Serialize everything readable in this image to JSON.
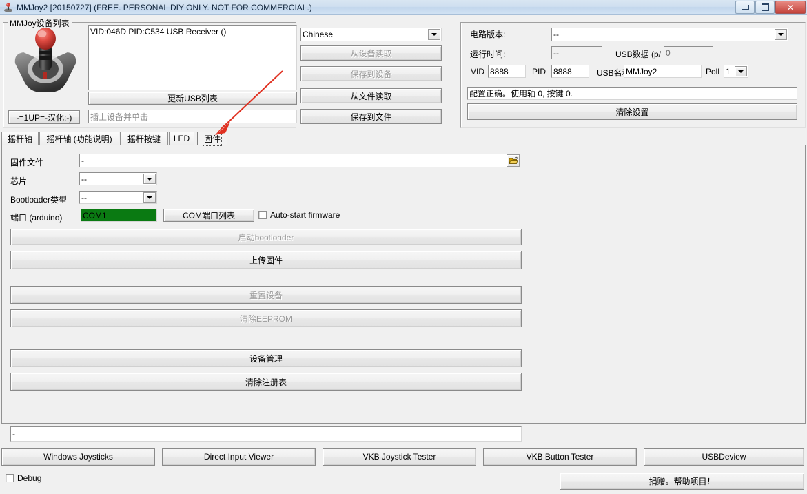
{
  "window": {
    "title": "MMJoy2 [20150727] (FREE. PERSONAL DIY ONLY. NOT FOR COMMERCIAL.)",
    "app_icon": "joystick-icon",
    "minimize_label": "",
    "maximize_label": "",
    "close_label": "✕"
  },
  "device_group": {
    "title": "MMJoy设备列表",
    "device_list": [
      "VID:046D PID:C534 USB Receiver ()"
    ],
    "refresh_usb_label": "更新USB列表",
    "hint_placeholder": "插上设备并单击",
    "translator_label": "-=1UP=-汉化:-)"
  },
  "actions": {
    "language_value": "Chinese",
    "read_from_device": "从设备读取",
    "save_to_device": "保存到设备",
    "read_from_file": "从文件读取",
    "save_to_file": "保存到文件"
  },
  "info": {
    "board_version_label": "电路版本:",
    "board_version_value": "--",
    "runtime_label": "运行时间:",
    "runtime_value": "--",
    "usb_rate_label": "USB数据 (p/",
    "usb_rate_value": "0",
    "vid_label": "VID",
    "vid_value": "8888",
    "pid_label": "PID",
    "pid_value": "8888",
    "usb_name_label": "USB名称",
    "usb_name_value": "MMJoy2",
    "poll_label": "Poll",
    "poll_value": "1",
    "status_value": "配置正确。使用轴 0, 按键 0.",
    "clear_settings": "清除设置"
  },
  "tabs": [
    {
      "label": "摇杆轴",
      "selected": false
    },
    {
      "label": "摇杆轴 (功能说明)",
      "selected": false
    },
    {
      "label": "摇杆按键",
      "selected": false
    },
    {
      "label": "LED",
      "selected": false
    },
    {
      "label": "固件",
      "selected": true
    }
  ],
  "firmware": {
    "file_label": "固件文件",
    "file_value": "-",
    "browse_icon": "open-folder-icon",
    "chip_label": "芯片",
    "chip_value": "--",
    "bootloader_label": "Bootloader类型",
    "bootloader_value": "--",
    "port_label": "端口 (arduino)",
    "port_value": "COM1",
    "port_bg_color": "#0a7a12",
    "com_list_button": "COM端口列表",
    "autostart_label": "Auto-start firmware",
    "autostart_checked": false,
    "buttons": [
      {
        "label": "启动bootloader",
        "enabled": false
      },
      {
        "label": "上传固件",
        "enabled": true
      },
      {
        "label": "重置设备",
        "enabled": false
      },
      {
        "label": "清除EEPROM",
        "enabled": false
      },
      {
        "label": "设备管理",
        "enabled": true
      },
      {
        "label": "清除注册表",
        "enabled": true
      }
    ]
  },
  "bottom": {
    "log_value": "-",
    "tools": [
      "Windows Joysticks",
      "Direct Input Viewer",
      "VKB Joystick Tester",
      "VKB Button Tester",
      "USBDeview"
    ],
    "debug_label": "Debug",
    "debug_checked": false,
    "donate_label": "捐赠。帮助项目！"
  },
  "annotation": {
    "arrow_color": "#e03020",
    "name": "red-arrow-pointing-to-firmware-tab"
  }
}
